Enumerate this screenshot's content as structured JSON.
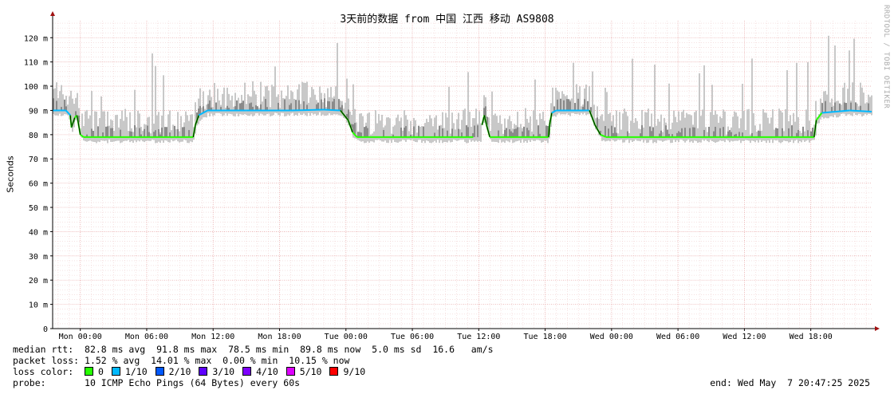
{
  "chart_data": {
    "type": "line",
    "title": "3天前的数据 from 中国 江西 移动 AS9808",
    "ylabel": "Seconds",
    "ylim": [
      0,
      127
    ],
    "y_ticks": [
      {
        "value": 0,
        "label": "0"
      },
      {
        "value": 10,
        "label": "10 m"
      },
      {
        "value": 20,
        "label": "20 m"
      },
      {
        "value": 30,
        "label": "30 m"
      },
      {
        "value": 40,
        "label": "40 m"
      },
      {
        "value": 50,
        "label": "50 m"
      },
      {
        "value": 60,
        "label": "60 m"
      },
      {
        "value": 70,
        "label": "70 m"
      },
      {
        "value": 80,
        "label": "80 m"
      },
      {
        "value": 90,
        "label": "90 m"
      },
      {
        "value": 100,
        "label": "100 m"
      },
      {
        "value": 110,
        "label": "110 m"
      },
      {
        "value": 120,
        "label": "120 m"
      }
    ],
    "x_hours_range": [
      -2.5,
      71.5
    ],
    "x_ticks": [
      {
        "hour": 0,
        "label": "Mon 00:00"
      },
      {
        "hour": 6,
        "label": "Mon 06:00"
      },
      {
        "hour": 12,
        "label": "Mon 12:00"
      },
      {
        "hour": 18,
        "label": "Mon 18:00"
      },
      {
        "hour": 24,
        "label": "Tue 00:00"
      },
      {
        "hour": 30,
        "label": "Tue 06:00"
      },
      {
        "hour": 36,
        "label": "Tue 12:00"
      },
      {
        "hour": 42,
        "label": "Tue 18:00"
      },
      {
        "hour": 48,
        "label": "Wed 00:00"
      },
      {
        "hour": 54,
        "label": "Wed 06:00"
      },
      {
        "hour": 60,
        "label": "Wed 12:00"
      },
      {
        "hour": 66,
        "label": "Wed 18:00"
      }
    ],
    "median_rtt_series": [
      [
        -2.5,
        90
      ],
      [
        -1.8,
        90
      ],
      [
        -1.3,
        90
      ],
      [
        -0.9,
        88
      ],
      [
        -0.8,
        83
      ],
      [
        -0.5,
        87
      ],
      [
        -0.3,
        88
      ],
      [
        0.0,
        80
      ],
      [
        0.3,
        79
      ],
      [
        1.5,
        79
      ],
      [
        4.5,
        79
      ],
      [
        8.5,
        79
      ],
      [
        10.2,
        79
      ],
      [
        10.4,
        84
      ],
      [
        10.7,
        88
      ],
      [
        11.5,
        90
      ],
      [
        15.0,
        90
      ],
      [
        19.0,
        90
      ],
      [
        22.0,
        90.3
      ],
      [
        23.5,
        90
      ],
      [
        24.2,
        86
      ],
      [
        24.6,
        81
      ],
      [
        25.0,
        79
      ],
      [
        30.0,
        79
      ],
      [
        35.5,
        79
      ],
      [
        36.2,
        79
      ],
      [
        36.3,
        84
      ],
      [
        36.5,
        88
      ],
      [
        36.7,
        84
      ],
      [
        37.0,
        79
      ],
      [
        42.3,
        79
      ],
      [
        42.4,
        84
      ],
      [
        42.6,
        89
      ],
      [
        43.0,
        90
      ],
      [
        45.5,
        90
      ],
      [
        46.0,
        90
      ],
      [
        46.5,
        84
      ],
      [
        47.0,
        80
      ],
      [
        47.5,
        79
      ],
      [
        55.0,
        79
      ],
      [
        60.0,
        79
      ],
      [
        66.3,
        79
      ],
      [
        66.5,
        86
      ],
      [
        67.0,
        89
      ],
      [
        69.5,
        90
      ],
      [
        71.5,
        89.5
      ]
    ],
    "gaps_hours": [
      [
        36.15,
        36.3
      ]
    ],
    "legend": {
      "median_rtt": {
        "label": "median rtt:",
        "avg": "82.8 ms avg",
        "max": "91.8 ms max",
        "min": "78.5 ms min",
        "now": "89.8 ms now",
        "sd": "5.0 ms sd",
        "am": "16.6   am/s"
      },
      "packet_loss": {
        "label": "packet loss:",
        "avg": "1.52 % avg",
        "max": "14.01 % max",
        "min": "0.00 % min",
        "now": "10.15 % now"
      },
      "loss_color": {
        "label": "loss color:",
        "items": [
          {
            "label": "0",
            "color": "#26ff00"
          },
          {
            "label": "1/10",
            "color": "#00b8ff"
          },
          {
            "label": "2/10",
            "color": "#0059ff"
          },
          {
            "label": "3/10",
            "color": "#5e00ff"
          },
          {
            "label": "4/10",
            "color": "#7e00ff"
          },
          {
            "label": "5/10",
            "color": "#dd00ff"
          },
          {
            "label": "9/10",
            "color": "#ff0000"
          }
        ]
      },
      "probe": {
        "label": "probe:",
        "text": "10 ICMP Echo Pings (64 Bytes) every 60s"
      },
      "end": "end: Wed May  7 20:47:25 2025"
    },
    "watermark": "RRDTOOL / TOBI OETIKER",
    "colors": {
      "grid": "#e8a8a8",
      "axis": "#000000",
      "smoke": "#c8c8c8",
      "smoke_dark": "#8a8a8a",
      "arrow": "#a01010"
    }
  }
}
